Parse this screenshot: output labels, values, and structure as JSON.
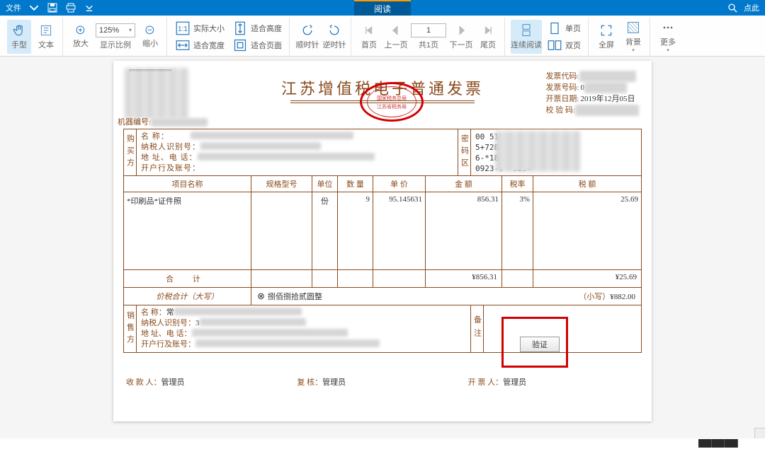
{
  "menubar": {
    "file_label": "文件",
    "tab_read_label": "阅读",
    "search_placeholder": "点此"
  },
  "ribbon": {
    "hand": "手型",
    "text": "文本",
    "zoom_in": "放大",
    "zoom_value": "125%",
    "zoom_label": "显示比例",
    "zoom_out": "缩小",
    "actual_size": "实际大小",
    "fit_width": "适合宽度",
    "fit_height": "适合高度",
    "fit_page": "适合页面",
    "rotate_cw": "顺时针",
    "rotate_ccw": "逆时针",
    "first_page": "首页",
    "prev_page": "上一页",
    "page_current": "1",
    "page_total_label": "共1页",
    "next_page": "下一页",
    "last_page": "尾页",
    "continuous": "连续阅读",
    "single_page": "单页",
    "double_page": "双页",
    "fullscreen": "全屏",
    "background": "背景",
    "more": "更多"
  },
  "invoice": {
    "title": "江苏增值税电子普通发票",
    "seal_line1": "国家税务总局",
    "seal_line2": "江苏省税务局",
    "machine_no_label": "机器编号:",
    "code_label": "发票代码:",
    "number_label": "发票号码:",
    "date_label": "开票日期:",
    "date_value": "2019年12月05日",
    "check_label": "校 验 码:",
    "buyer_label": "购买方",
    "buyer_name_label": "名        称：",
    "buyer_taxid_label": "纳税人识别号：",
    "buyer_addr_label": "地 址、电 话：",
    "buyer_bank_label": "开户行及账号：",
    "cipher_label": "密码区",
    "cipher_lines": [
      "00                           51304",
      "5+728                     36-752",
      "                              6-*183",
      "0923-0                     *525>"
    ],
    "col_name": "项目名称",
    "col_spec": "规格型号",
    "col_unit": "单位",
    "col_qty": "数 量",
    "col_price": "单 价",
    "col_amount": "金 额",
    "col_rate": "税率",
    "col_tax": "税 额",
    "item_name": "*印刷品*证件照",
    "item_unit": "份",
    "item_qty": "9",
    "item_price": "95.145631",
    "item_amount": "856.31",
    "item_rate": "3%",
    "item_tax": "25.69",
    "sum_label": "合   计",
    "sum_amount": "¥856.31",
    "sum_tax": "¥25.69",
    "total_label": "价税合计（大写）",
    "total_upper": "捌佰捌拾贰圆整",
    "total_lower_label": "（小写）",
    "total_lower": "¥882.00",
    "seller_label": "销售方",
    "seller_name_label": "名        称：",
    "seller_taxid_label": "纳税人识别号：",
    "seller_addr_label": "地 址、电 话：",
    "seller_bank_label": "开户行及账号：",
    "remark_label": "备注",
    "payee_label": "收 款 人：",
    "payee": "管理员",
    "reviewer_label": "复 核：",
    "reviewer": "管理员",
    "drawer_label": "开 票 人：",
    "drawer": "管理员",
    "verify_btn": "验证"
  }
}
